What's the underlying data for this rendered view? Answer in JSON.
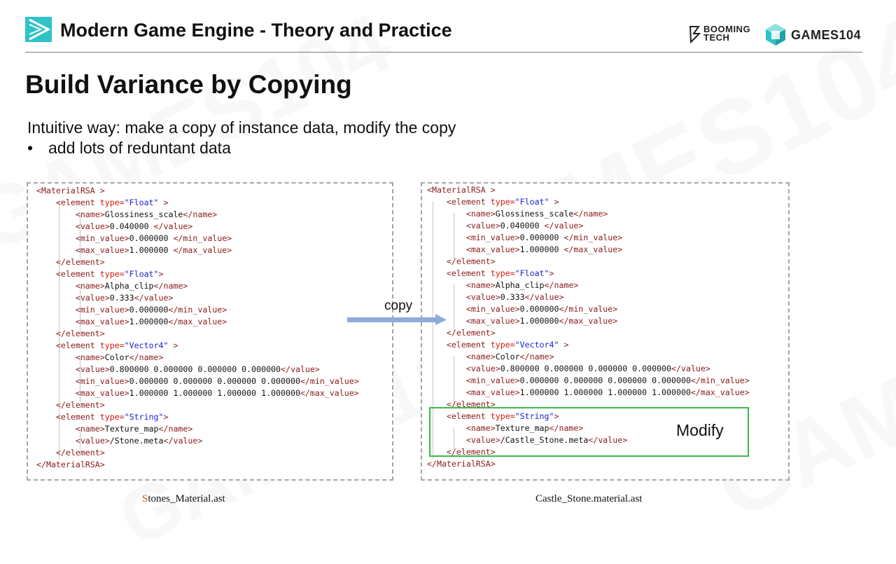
{
  "header": {
    "course_title": "Modern Game Engine - Theory and Practice",
    "brand_booming_line1": "BOOMING",
    "brand_booming_line2": "TECH",
    "brand_games": "GAMES104"
  },
  "slide": {
    "title": "Build Variance by Copying",
    "intro": "Intuitive way: make a copy of instance data, modify the copy",
    "bullet": "add lots of reduntant data",
    "bullet_symbol": "•"
  },
  "left_panel": {
    "caption_first": "S",
    "caption_rest": "tones_Material.ast",
    "lines": [
      {
        "indent": 0,
        "parts": [
          {
            "t": "tag",
            "v": "<MaterialRSA >"
          }
        ]
      },
      {
        "indent": 1,
        "parts": [
          {
            "t": "tag",
            "v": "<element "
          },
          {
            "t": "attr",
            "v": "type="
          },
          {
            "t": "str",
            "v": "\"Float\""
          },
          {
            "t": "tag",
            "v": " >"
          }
        ]
      },
      {
        "indent": 2,
        "parts": [
          {
            "t": "tag",
            "v": "<name>"
          },
          {
            "t": "txt",
            "v": "Glossiness_scale"
          },
          {
            "t": "tag",
            "v": "</name>"
          }
        ]
      },
      {
        "indent": 2,
        "parts": [
          {
            "t": "tag",
            "v": "<value>"
          },
          {
            "t": "txt",
            "v": "0.040000 "
          },
          {
            "t": "tag",
            "v": "</value>"
          }
        ]
      },
      {
        "indent": 2,
        "parts": [
          {
            "t": "tag",
            "v": "<min_value>"
          },
          {
            "t": "txt",
            "v": "0.000000 "
          },
          {
            "t": "tag",
            "v": "</min_value>"
          }
        ]
      },
      {
        "indent": 2,
        "parts": [
          {
            "t": "tag",
            "v": "<max_value>"
          },
          {
            "t": "txt",
            "v": "1.000000 "
          },
          {
            "t": "tag",
            "v": "</max_value>"
          }
        ]
      },
      {
        "indent": 1,
        "parts": [
          {
            "t": "tag",
            "v": "</element>"
          }
        ]
      },
      {
        "indent": 1,
        "parts": [
          {
            "t": "tag",
            "v": "<element "
          },
          {
            "t": "attr",
            "v": "type="
          },
          {
            "t": "str",
            "v": "\"Float\""
          },
          {
            "t": "tag",
            "v": ">"
          }
        ]
      },
      {
        "indent": 2,
        "parts": [
          {
            "t": "tag",
            "v": "<name>"
          },
          {
            "t": "txt",
            "v": "Alpha_clip"
          },
          {
            "t": "tag",
            "v": "</name>"
          }
        ]
      },
      {
        "indent": 2,
        "parts": [
          {
            "t": "tag",
            "v": "<value>"
          },
          {
            "t": "txt",
            "v": "0.333"
          },
          {
            "t": "tag",
            "v": "</value>"
          }
        ]
      },
      {
        "indent": 2,
        "parts": [
          {
            "t": "tag",
            "v": "<min_value>"
          },
          {
            "t": "txt",
            "v": "0.000000"
          },
          {
            "t": "tag",
            "v": "</min_value>"
          }
        ]
      },
      {
        "indent": 2,
        "parts": [
          {
            "t": "tag",
            "v": "<max_value>"
          },
          {
            "t": "txt",
            "v": "1.000000"
          },
          {
            "t": "tag",
            "v": "</max_value>"
          }
        ]
      },
      {
        "indent": 1,
        "parts": [
          {
            "t": "tag",
            "v": "</element>"
          }
        ]
      },
      {
        "indent": 1,
        "parts": [
          {
            "t": "tag",
            "v": "<element "
          },
          {
            "t": "attr",
            "v": "type="
          },
          {
            "t": "str",
            "v": "\"Vector4\""
          },
          {
            "t": "tag",
            "v": " >"
          }
        ]
      },
      {
        "indent": 2,
        "parts": [
          {
            "t": "tag",
            "v": "<name>"
          },
          {
            "t": "txt",
            "v": "Color"
          },
          {
            "t": "tag",
            "v": "</name>"
          }
        ]
      },
      {
        "indent": 2,
        "parts": [
          {
            "t": "tag",
            "v": "<value>"
          },
          {
            "t": "txt",
            "v": "0.800000 0.000000 0.000000 0.000000"
          },
          {
            "t": "tag",
            "v": "</value>"
          }
        ]
      },
      {
        "indent": 2,
        "parts": [
          {
            "t": "tag",
            "v": "<min_value>"
          },
          {
            "t": "txt",
            "v": "0.000000 0.000000 0.000000 0.000000"
          },
          {
            "t": "tag",
            "v": "</min_value>"
          }
        ]
      },
      {
        "indent": 2,
        "parts": [
          {
            "t": "tag",
            "v": "<max_value>"
          },
          {
            "t": "txt",
            "v": "1.000000 1.000000 1.000000 1.000000"
          },
          {
            "t": "tag",
            "v": "</max_value>"
          }
        ]
      },
      {
        "indent": 1,
        "parts": [
          {
            "t": "tag",
            "v": "</element>"
          }
        ]
      },
      {
        "indent": 1,
        "parts": [
          {
            "t": "tag",
            "v": "<element "
          },
          {
            "t": "attr",
            "v": "type="
          },
          {
            "t": "str",
            "v": "\"String\""
          },
          {
            "t": "tag",
            "v": ">"
          }
        ]
      },
      {
        "indent": 2,
        "parts": [
          {
            "t": "tag",
            "v": "<name>"
          },
          {
            "t": "txt",
            "v": "Texture_map"
          },
          {
            "t": "tag",
            "v": "</name>"
          }
        ]
      },
      {
        "indent": 2,
        "parts": [
          {
            "t": "tag",
            "v": "<value>"
          },
          {
            "t": "txt",
            "v": "/Stone.meta"
          },
          {
            "t": "tag",
            "v": "</value>"
          }
        ]
      },
      {
        "indent": 1,
        "parts": [
          {
            "t": "tag",
            "v": "</element>"
          }
        ]
      },
      {
        "indent": 0,
        "parts": [
          {
            "t": "tag",
            "v": "</MaterialRSA>"
          }
        ]
      }
    ]
  },
  "right_panel": {
    "caption": "Castle_Stone.material.ast",
    "lines": [
      {
        "indent": 0,
        "parts": [
          {
            "t": "tag",
            "v": "<MaterialRSA >"
          }
        ]
      },
      {
        "indent": 1,
        "parts": [
          {
            "t": "tag",
            "v": "<element "
          },
          {
            "t": "attr",
            "v": "type="
          },
          {
            "t": "str",
            "v": "\"Float\""
          },
          {
            "t": "tag",
            "v": " >"
          }
        ]
      },
      {
        "indent": 2,
        "parts": [
          {
            "t": "tag",
            "v": "<name>"
          },
          {
            "t": "txt",
            "v": "Glossiness_scale"
          },
          {
            "t": "tag",
            "v": "</name>"
          }
        ]
      },
      {
        "indent": 2,
        "parts": [
          {
            "t": "tag",
            "v": "<value>"
          },
          {
            "t": "txt",
            "v": "0.040000 "
          },
          {
            "t": "tag",
            "v": "</value>"
          }
        ]
      },
      {
        "indent": 2,
        "parts": [
          {
            "t": "tag",
            "v": "<min_value>"
          },
          {
            "t": "txt",
            "v": "0.000000 "
          },
          {
            "t": "tag",
            "v": "</min_value>"
          }
        ]
      },
      {
        "indent": 2,
        "parts": [
          {
            "t": "tag",
            "v": "<max_value>"
          },
          {
            "t": "txt",
            "v": "1.000000 "
          },
          {
            "t": "tag",
            "v": "</max_value>"
          }
        ]
      },
      {
        "indent": 1,
        "parts": [
          {
            "t": "tag",
            "v": "</element>"
          }
        ]
      },
      {
        "indent": 1,
        "parts": [
          {
            "t": "tag",
            "v": "<element "
          },
          {
            "t": "attr",
            "v": "type="
          },
          {
            "t": "str",
            "v": "\"Float\""
          },
          {
            "t": "tag",
            "v": ">"
          }
        ]
      },
      {
        "indent": 2,
        "parts": [
          {
            "t": "tag",
            "v": "<name>"
          },
          {
            "t": "txt",
            "v": "Alpha_clip"
          },
          {
            "t": "tag",
            "v": "</name>"
          }
        ]
      },
      {
        "indent": 2,
        "parts": [
          {
            "t": "tag",
            "v": "<value>"
          },
          {
            "t": "txt",
            "v": "0.333"
          },
          {
            "t": "tag",
            "v": "</value>"
          }
        ]
      },
      {
        "indent": 2,
        "parts": [
          {
            "t": "tag",
            "v": "<min_value>"
          },
          {
            "t": "txt",
            "v": "0.000000"
          },
          {
            "t": "tag",
            "v": "</min_value>"
          }
        ]
      },
      {
        "indent": 2,
        "parts": [
          {
            "t": "tag",
            "v": "<max_value>"
          },
          {
            "t": "txt",
            "v": "1.000000"
          },
          {
            "t": "tag",
            "v": "</max_value>"
          }
        ]
      },
      {
        "indent": 1,
        "parts": [
          {
            "t": "tag",
            "v": "</element>"
          }
        ]
      },
      {
        "indent": 1,
        "parts": [
          {
            "t": "tag",
            "v": "<element "
          },
          {
            "t": "attr",
            "v": "type="
          },
          {
            "t": "str",
            "v": "\"Vector4\""
          },
          {
            "t": "tag",
            "v": " >"
          }
        ]
      },
      {
        "indent": 2,
        "parts": [
          {
            "t": "tag",
            "v": "<name>"
          },
          {
            "t": "txt",
            "v": "Color"
          },
          {
            "t": "tag",
            "v": "</name>"
          }
        ]
      },
      {
        "indent": 2,
        "parts": [
          {
            "t": "tag",
            "v": "<value>"
          },
          {
            "t": "txt",
            "v": "0.800000 0.000000 0.000000 0.000000"
          },
          {
            "t": "tag",
            "v": "</value>"
          }
        ]
      },
      {
        "indent": 2,
        "parts": [
          {
            "t": "tag",
            "v": "<min_value>"
          },
          {
            "t": "txt",
            "v": "0.000000 0.000000 0.000000 0.000000"
          },
          {
            "t": "tag",
            "v": "</min_value>"
          }
        ]
      },
      {
        "indent": 2,
        "parts": [
          {
            "t": "tag",
            "v": "<max_value>"
          },
          {
            "t": "txt",
            "v": "1.000000 1.000000 1.000000 1.000000"
          },
          {
            "t": "tag",
            "v": "</max_value>"
          }
        ]
      },
      {
        "indent": 1,
        "parts": [
          {
            "t": "tag",
            "v": "</element>"
          }
        ]
      },
      {
        "indent": 1,
        "parts": [
          {
            "t": "tag",
            "v": "<element "
          },
          {
            "t": "attr",
            "v": "type="
          },
          {
            "t": "str",
            "v": "\"String\""
          },
          {
            "t": "tag",
            "v": ">"
          }
        ]
      },
      {
        "indent": 2,
        "parts": [
          {
            "t": "tag",
            "v": "<name>"
          },
          {
            "t": "txt",
            "v": "Texture_map"
          },
          {
            "t": "tag",
            "v": "</name>"
          }
        ]
      },
      {
        "indent": 2,
        "parts": [
          {
            "t": "tag",
            "v": "<value>"
          },
          {
            "t": "txt",
            "v": "/Castle_Stone.meta"
          },
          {
            "t": "tag",
            "v": "</value>"
          }
        ]
      },
      {
        "indent": 1,
        "parts": [
          {
            "t": "tag",
            "v": "</element>"
          }
        ]
      },
      {
        "indent": 0,
        "parts": [
          {
            "t": "tag",
            "v": "</MaterialRSA>"
          }
        ]
      }
    ]
  },
  "arrow": {
    "label": "copy",
    "color": "#8eabd9"
  },
  "modify": {
    "label": "Modify",
    "box_color": "#3cb84a"
  },
  "colors": {
    "tag": "#8b1a1a",
    "attr": "#d2190e",
    "string": "#1b23d6",
    "logo_teal": "#2fc3c8"
  },
  "watermarks": [
    "GAMES104",
    "GAMES104",
    "GAMES104",
    "GAMES104"
  ]
}
